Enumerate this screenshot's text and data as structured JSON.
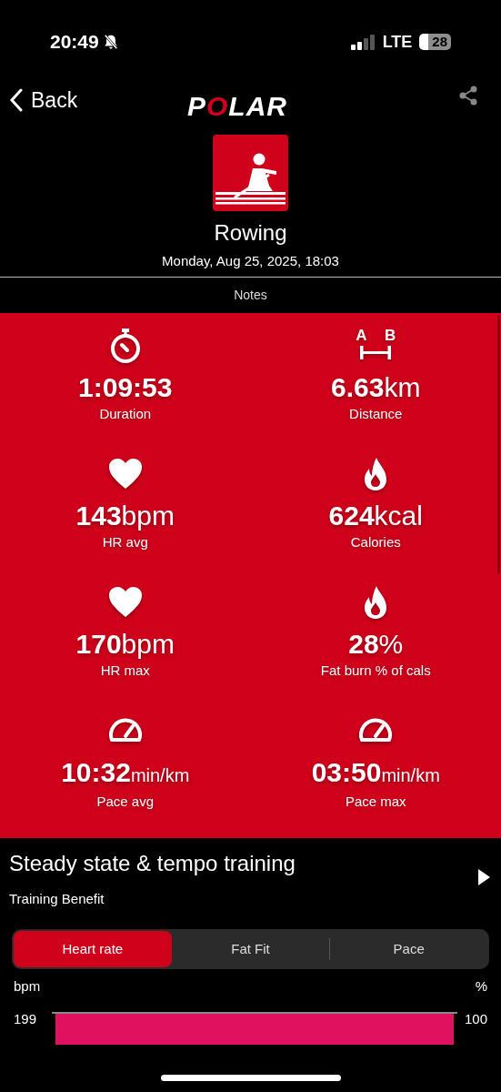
{
  "status_bar": {
    "time": "20:49",
    "silent": true,
    "network": "LTE",
    "battery": "28"
  },
  "header": {
    "back": "Back",
    "logo": "POLAR"
  },
  "sport": {
    "name": "Rowing",
    "date": "Monday, Aug 25, 2025, 18:03"
  },
  "notes_tab": "Notes",
  "distance_icon_letters": [
    "A",
    "B"
  ],
  "metrics": [
    {
      "kind": "stopwatch",
      "value": "1:09:53",
      "label": "Duration"
    },
    {
      "kind": "distance",
      "value": "6.63",
      "unit": "km",
      "label": "Distance"
    },
    {
      "kind": "heart",
      "value": "143",
      "unit": "bpm",
      "label": "HR avg"
    },
    {
      "kind": "flame",
      "value": "624",
      "unit": "kcal",
      "label": "Calories"
    },
    {
      "kind": "heart",
      "value": "170",
      "unit": "bpm",
      "label": "HR max"
    },
    {
      "kind": "flame",
      "value": "28",
      "unit": "%",
      "label": "Fat burn % of cals"
    },
    {
      "kind": "gauge",
      "value": "10:32",
      "unit": "min/km",
      "label": "Pace avg"
    },
    {
      "kind": "gauge",
      "value": "03:50",
      "unit": "min/km",
      "label": "Pace max"
    }
  ],
  "training": {
    "title": "Steady state & tempo training",
    "subtitle": "Training Benefit"
  },
  "segments": [
    {
      "label": "Heart rate",
      "selected": true
    },
    {
      "label": "Fat Fit",
      "selected": false
    },
    {
      "label": "Pace",
      "selected": false
    }
  ],
  "chart": {
    "left_unit": "bpm",
    "right_unit": "%",
    "left_tick": "199",
    "right_tick": "100"
  }
}
